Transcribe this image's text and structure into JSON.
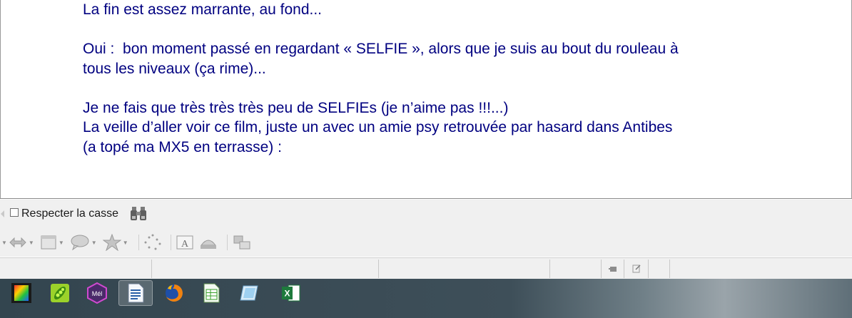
{
  "document": {
    "paragraphs": [
      "La fin est assez marrante, au fond...",
      "",
      "Oui :  bon moment passé en regardant « SELFIE », alors que je suis au bout du rouleau à",
      "tous les niveaux (ça rime)...",
      "",
      "Je ne fais que très très très peu de SELFIEs (je n’aime pas !!!...)",
      "La veille d’aller voir ce film, juste un avec un amie psy retrouvée par hasard dans Antibes",
      "(a topé ma MX5 en terrasse) :"
    ],
    "text_color": "#000080"
  },
  "find_bar": {
    "match_case_label": "Respecter la casse",
    "match_case_checked": false
  },
  "drawing_toolbar": {
    "icons": [
      "line-arrow-icon",
      "double-arrow-icon",
      "flowchart-icon",
      "callout-icon",
      "star-icon",
      "points-icon",
      "fontwork-icon",
      "3d-extrusion-icon",
      "group-icon"
    ]
  },
  "taskbar": {
    "apps": [
      {
        "name": "video-editor-icon",
        "active": false
      },
      {
        "name": "pea-app-icon",
        "active": false
      },
      {
        "name": "mel-app-icon",
        "active": false
      },
      {
        "name": "writer-icon",
        "active": true
      },
      {
        "name": "firefox-icon",
        "active": false
      },
      {
        "name": "calc-icon",
        "active": false
      },
      {
        "name": "ebook-app-icon",
        "active": false
      },
      {
        "name": "excel-icon",
        "active": false
      }
    ],
    "mel_label": "Mél"
  }
}
